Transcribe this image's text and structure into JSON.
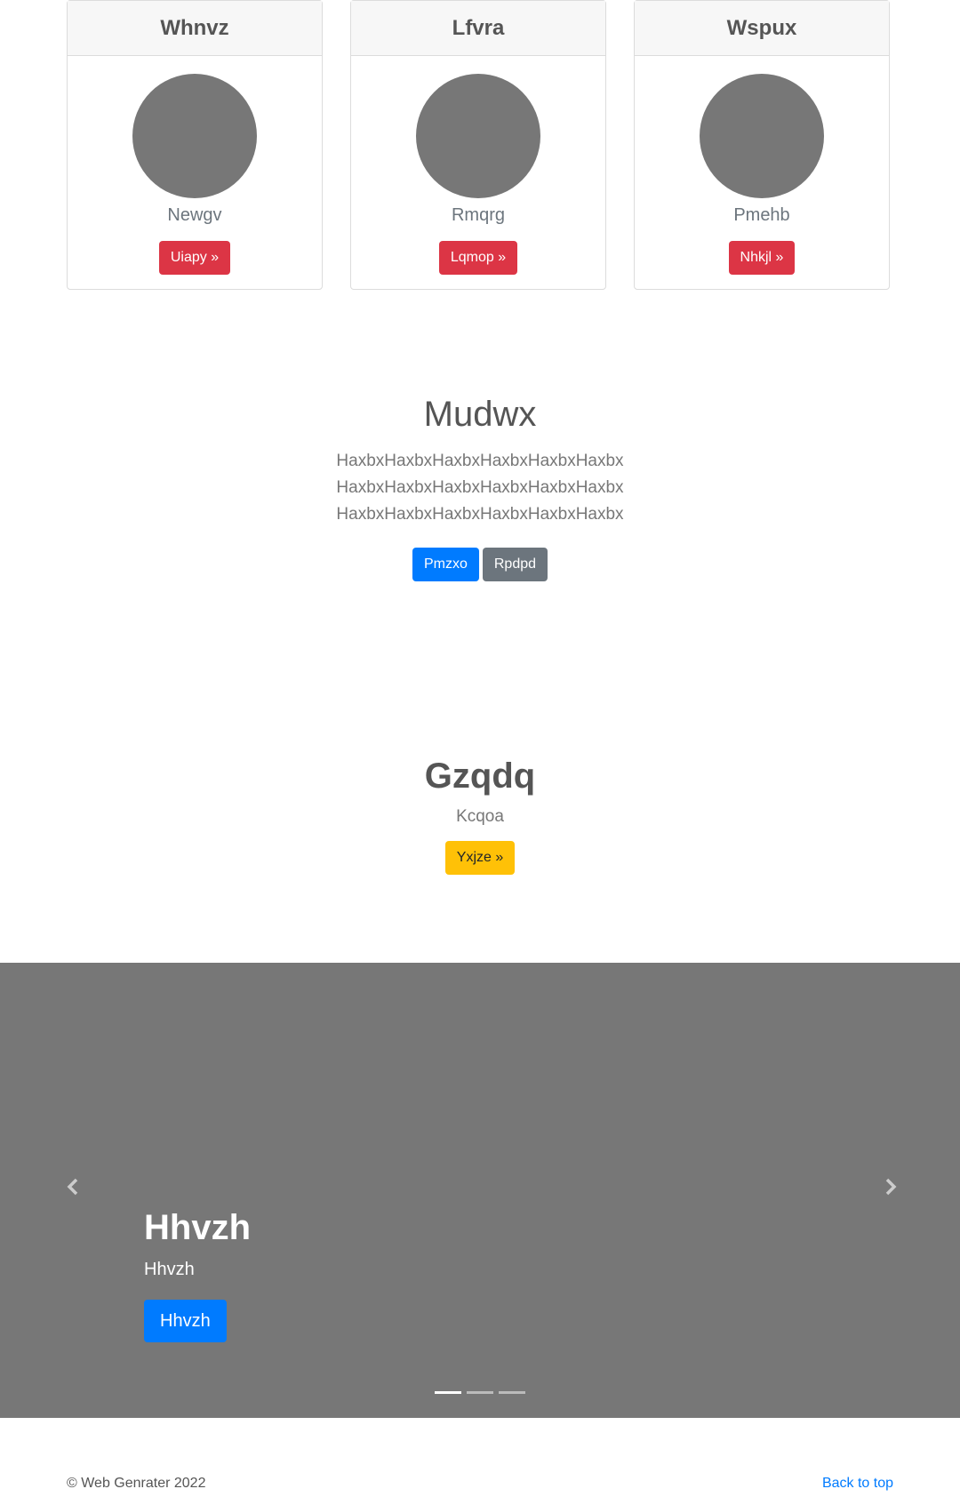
{
  "cards": [
    {
      "title": "Whnvz",
      "subtitle": "Newgv",
      "button": "Uiapy »"
    },
    {
      "title": "Lfvra",
      "subtitle": "Rmqrg",
      "button": "Lqmop »"
    },
    {
      "title": "Wspux",
      "subtitle": "Pmehb",
      "button": "Nhkjl »"
    }
  ],
  "hero": {
    "title": "Mudwx",
    "text": "HaxbxHaxbxHaxbxHaxbxHaxbxHaxbxHaxbxHaxbxHaxbxHaxbxHaxbxHaxbxHaxbxHaxbxHaxbxHaxbxHaxbxHaxbx",
    "primary_button": "Pmzxo",
    "secondary_button": "Rpdpd"
  },
  "feature": {
    "title": "Gzqdq",
    "subtitle": "Kcqoa",
    "button": "Yxjze »"
  },
  "carousel": {
    "caption_title": "Hhvzh",
    "caption_text": "Hhvzh",
    "caption_button": "Hhvzh",
    "prev_icon": "chevron-left-icon",
    "next_icon": "chevron-right-icon",
    "slide_count": 3,
    "active_slide": 1
  },
  "footer": {
    "copyright": "© Web Genrater 2022",
    "back_to_top": "Back to top"
  },
  "colors": {
    "danger": "#dc3545",
    "primary": "#007bff",
    "secondary": "#6c757d",
    "warning": "#ffc107",
    "placeholder_gray": "#777777"
  }
}
